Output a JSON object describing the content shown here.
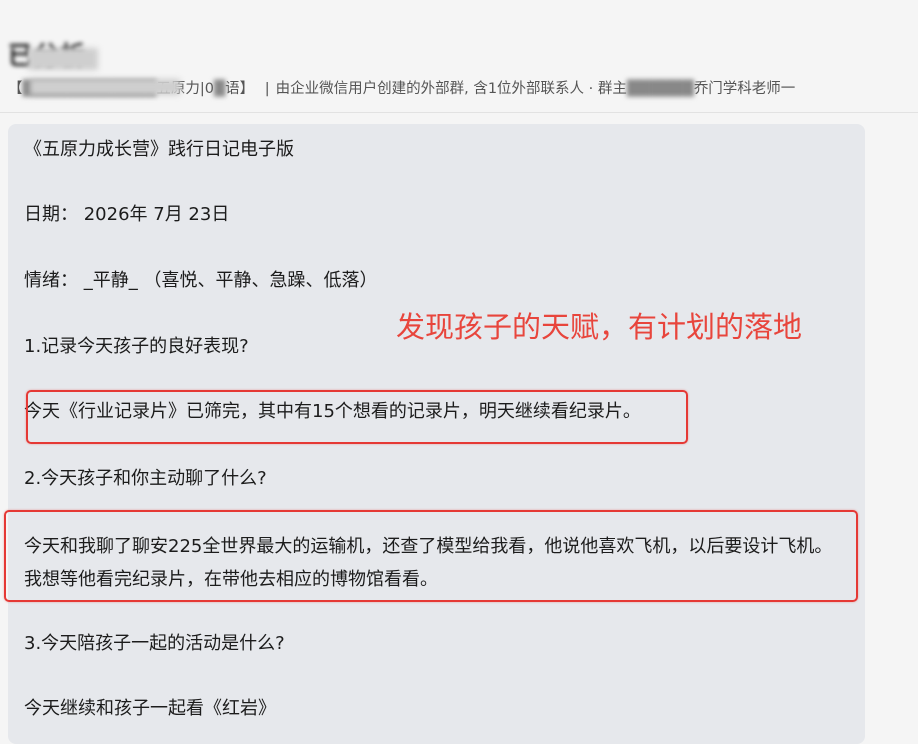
{
  "header": {
    "title": "已分析",
    "group_prefix": "【",
    "group_name_fragment": "五原力|0",
    "group_name_fragment2": "语】",
    "separator": "|",
    "group_description": "由企业微信用户创建的外部群, 含1位外部联系人 · 群主",
    "group_owner_suffix": "乔门学科老师一"
  },
  "message": {
    "doc_title": "《五原力成长营》践行日记电子版",
    "date_line": "日期： 2026年 7月 23日",
    "mood_line": "情绪： _平静_ （喜悦、平静、急躁、低落）",
    "q1": "1.记录今天孩子的良好表现?",
    "a1": "今天《行业记录片》已筛完，其中有15个想看的记录片，明天继续看纪录片。",
    "q2": "2.今天孩子和你主动聊了什么?",
    "a2": "今天和我聊了聊安225全世界最大的运输机，还查了模型给我看，他说他喜欢飞机，以后要设计飞机。我想等他看完纪录片，在带他去相应的博物馆看看。",
    "q3": "3.今天陪孩子一起的活动是什么?",
    "a3": "今天继续和孩子一起看《红岩》"
  },
  "annotation": {
    "text": "发现孩子的天赋，有计划的落地",
    "color": "#e8453c"
  },
  "colors": {
    "bubble": "#e6e8ec",
    "highlight_box": "#e53935",
    "background": "#f5f5f5"
  }
}
